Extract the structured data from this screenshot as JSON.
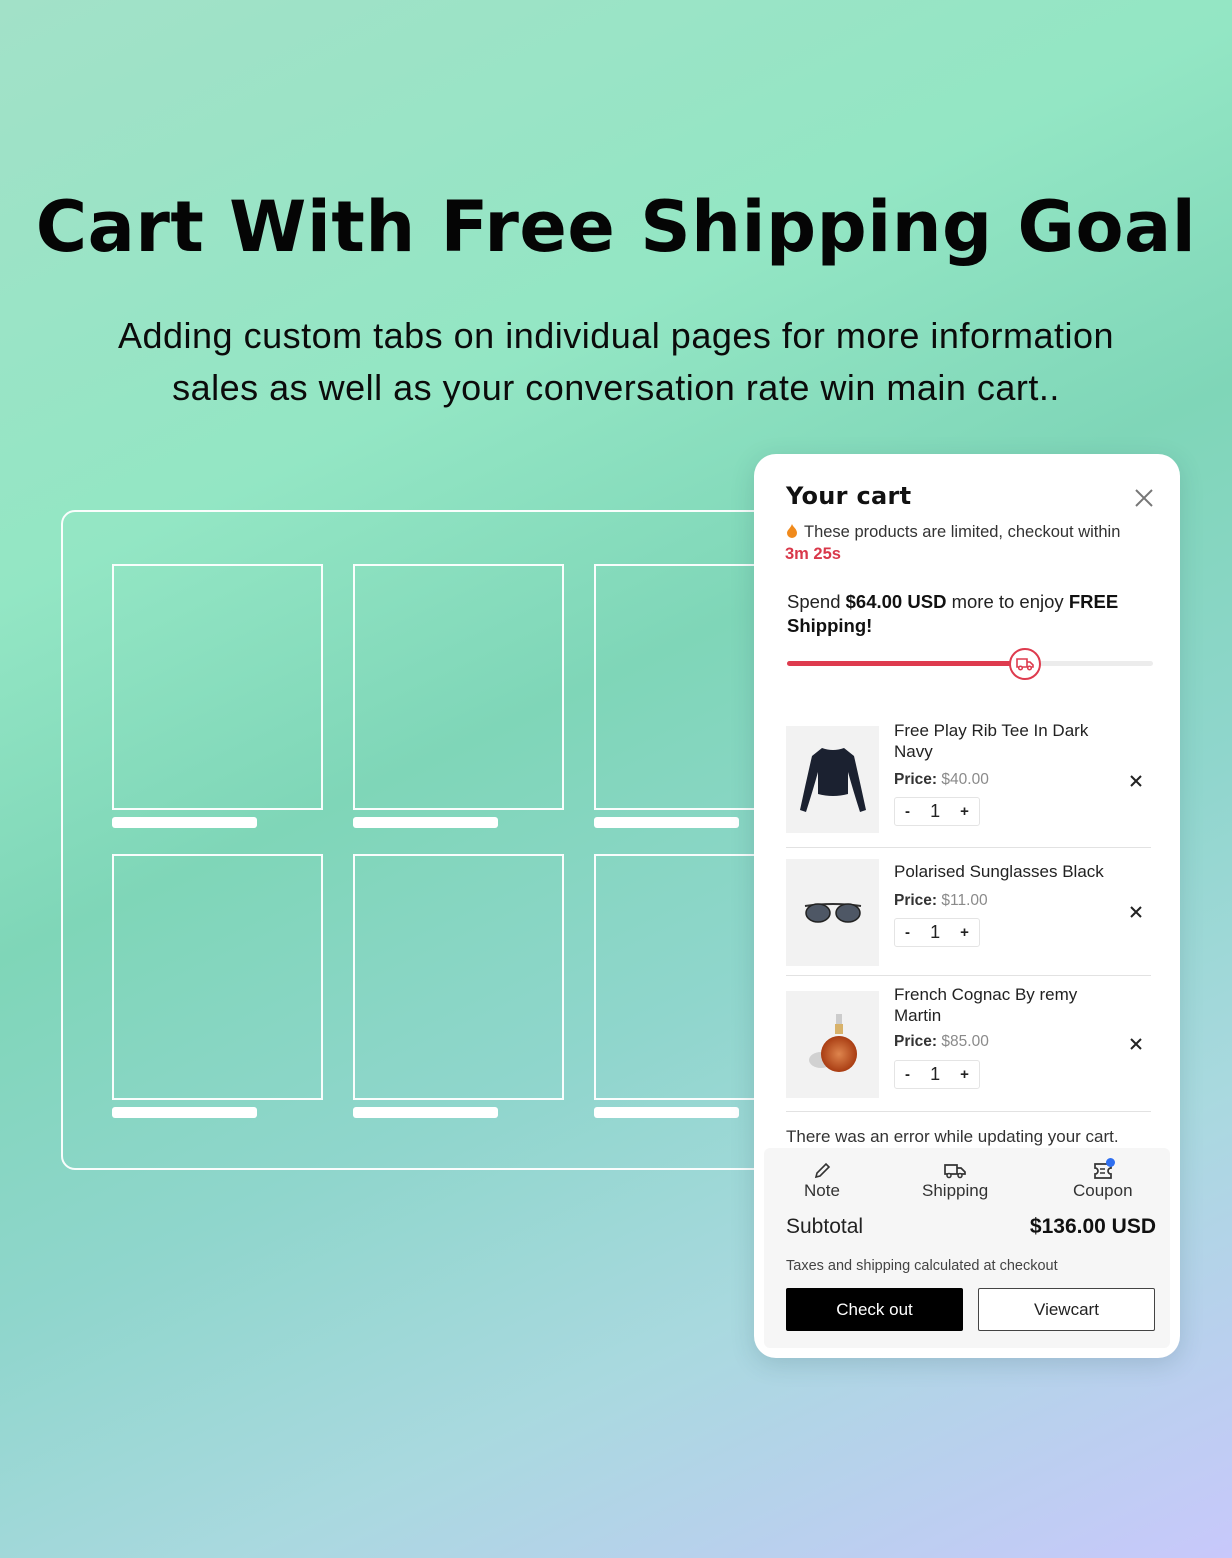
{
  "hero": {
    "title": "Cart With Free Shipping Goal",
    "subtitle_line1": "Adding custom tabs on individual pages for more information",
    "subtitle_line2": "sales as well as your conversation rate win main cart.."
  },
  "cart": {
    "title": "Your cart",
    "close_icon": "close-icon",
    "urgency": {
      "icon": "flame-icon",
      "text": "These products are limited, checkout within",
      "timer": "3m 25s"
    },
    "shipping_goal": {
      "prefix": "Spend",
      "amount": "$64.00 USD",
      "middle": "more to enjoy",
      "free": "FREE",
      "suffix": "Shipping!",
      "progress": 0.65,
      "marker_icon": "truck-icon"
    },
    "price_label": "Price:",
    "items": [
      {
        "name": "Free Play Rib Tee In Dark Navy",
        "price": "$40.00",
        "qty": "1",
        "image": "navy-crop-top"
      },
      {
        "name": "Polarised Sunglasses Black",
        "price": "$11.00",
        "qty": "1",
        "image": "sunglasses"
      },
      {
        "name": "French Cognac By remy Martin",
        "price": "$85.00",
        "qty": "1",
        "image": "cognac-bottle"
      }
    ],
    "qty_minus": "-",
    "qty_plus": "+",
    "error_message": "There was an error while updating your cart.",
    "tools": [
      {
        "label": "Note",
        "icon": "pencil-icon"
      },
      {
        "label": "Shipping",
        "icon": "truck-icon"
      },
      {
        "label": "Coupon",
        "icon": "ticket-icon",
        "badge": true
      }
    ],
    "subtotal_label": "Subtotal",
    "subtotal_value": "$136.00 USD",
    "tax_note": "Taxes and shipping calculated at checkout",
    "checkout_label": "Check out",
    "viewcart_label": "Viewcart",
    "colors": {
      "accent": "#de3b4e",
      "timer": "#d9384a",
      "badge": "#2f6ff0"
    }
  }
}
